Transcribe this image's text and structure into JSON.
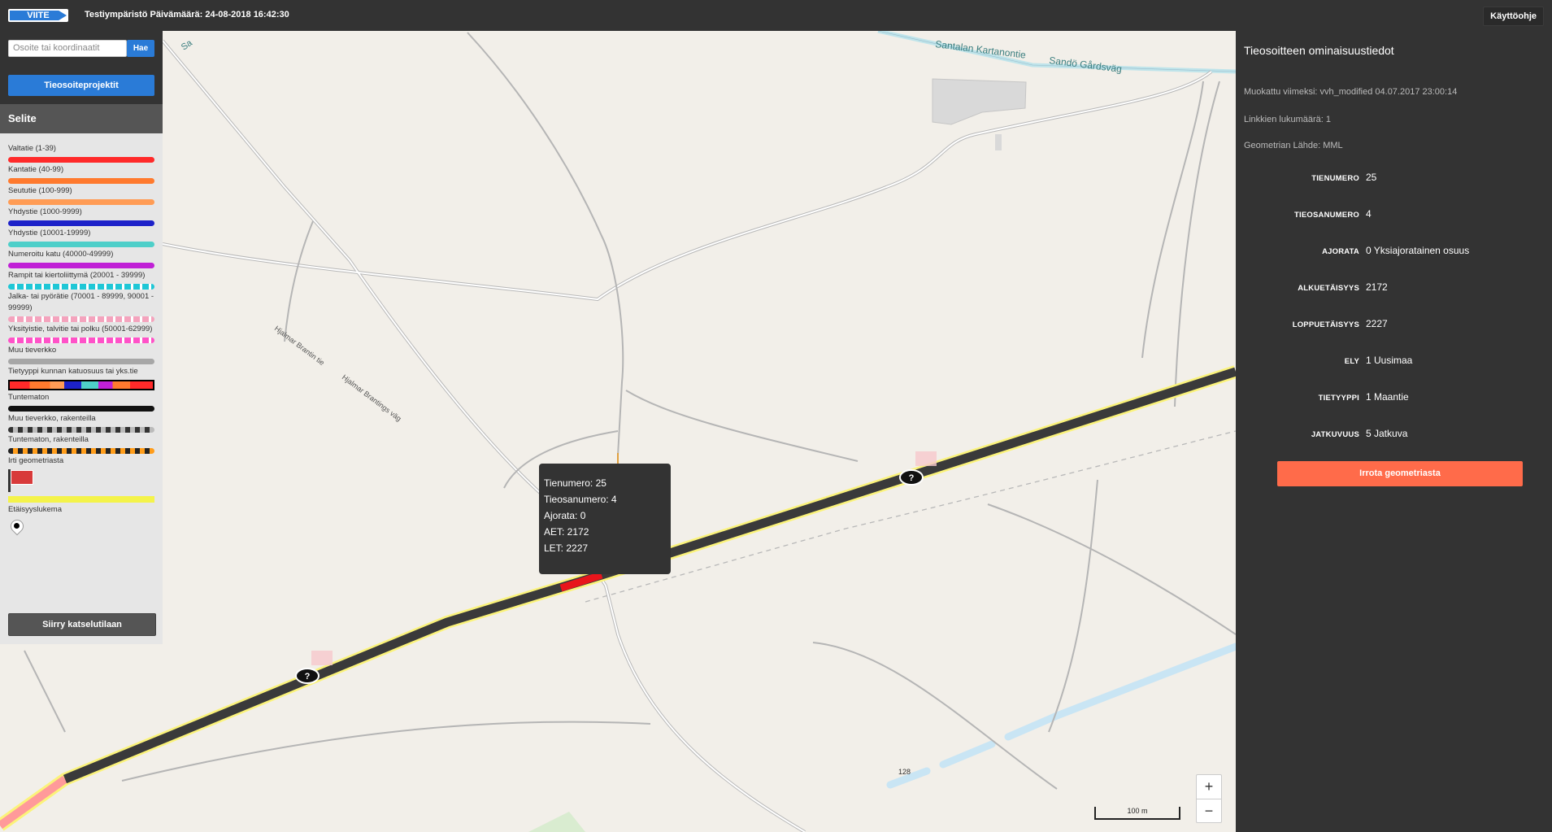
{
  "header": {
    "logo": "VIITE",
    "env": "Testiympäristö Päivämäärä: 24-08-2018 16:42:30",
    "help": "Käyttöohje"
  },
  "search": {
    "placeholder": "Osoite tai koordinaatit",
    "button": "Hae"
  },
  "projects_button": "Tieosoiteprojektit",
  "legend": {
    "title": "Selite",
    "items": [
      {
        "label": "Valtatie (1-39)",
        "color": "#ff2a2a"
      },
      {
        "label": "Kantatie (40-99)",
        "color": "#ff7a2e"
      },
      {
        "label": "Seututie (100-999)",
        "color": "#ff9c55"
      },
      {
        "label": "Yhdystie (1000-9999)",
        "color": "#1d22c9"
      },
      {
        "label": "Yhdystie (10001-19999)",
        "color": "#4ecfc9"
      },
      {
        "label": "Numeroitu katu (40000-49999)",
        "color": "#c020d6"
      },
      {
        "label": "Rampit tai kiertoliittymä (20001 - 39999)",
        "color": "#1fc7d6",
        "pattern": "dashed"
      },
      {
        "label": "Jalka- tai pyörätie (70001 - 89999, 90001 - 99999)",
        "color": "#f4a3bd",
        "pattern": "dashed"
      },
      {
        "label": "Yksityistie, talvitie tai polku (50001-62999)",
        "color": "#ff52c8",
        "pattern": "dashed"
      },
      {
        "label": "Muu tieverkko",
        "color": "#a7a7a7"
      },
      {
        "label": "Tietyyppi kunnan katuosuus tai yks.tie",
        "pattern": "multi"
      },
      {
        "label": "Tuntematon",
        "color": "#111111"
      },
      {
        "label": "Muu tieverkko, rakenteilla",
        "color": "#7f7f7f",
        "pattern": "checker"
      },
      {
        "label": "Tuntematon, rakenteilla",
        "color": "#ff9d1b",
        "pattern": "checker"
      },
      {
        "label": "Irti geometriasta",
        "pattern": "flag"
      },
      {
        "label": "Etäisyyslukema",
        "pattern": "marker"
      }
    ]
  },
  "goto_button": "Siirry katselutilaan",
  "details": {
    "title": "Tieosoitteen ominaisuustiedot",
    "modified": "Muokattu viimeksi: vvh_modified 04.07.2017 23:00:14",
    "links": "Linkkien lukumäärä: 1",
    "source": "Geometrian Lähde: MML",
    "fields": [
      {
        "key": "TIENUMERO",
        "value": "25"
      },
      {
        "key": "TIEOSANUMERO",
        "value": "4"
      },
      {
        "key": "AJORATA",
        "value": "0 Yksiajoratainen osuus"
      },
      {
        "key": "ALKUETÄISYYS",
        "value": "2172"
      },
      {
        "key": "LOPPUETÄISYYS",
        "value": "2227"
      },
      {
        "key": "ELY",
        "value": "1 Uusimaa"
      },
      {
        "key": "TIETYYPPI",
        "value": "1 Maantie"
      },
      {
        "key": "JATKUVUUS",
        "value": "5 Jatkuva"
      }
    ],
    "detach_button": "Irrota geometriasta"
  },
  "popup": {
    "lines": [
      "Tienumero: 25",
      "Tieosanumero: 4",
      "Ajorata: 0",
      "AET: 2172",
      "LET: 2227"
    ]
  },
  "map_labels": {
    "road_fi": "Santalan Kartanontie",
    "road_sv": "Sandö Gårdsväg",
    "street_fi": "Hjalmar Brantin tie",
    "street_sv": "Hjalmar Brantings väg",
    "marker_128": "128",
    "unknown_marker": "?",
    "cut_label": "Sa"
  },
  "zoom": {
    "plus": "+",
    "minus": "−"
  },
  "scale": "100 m"
}
